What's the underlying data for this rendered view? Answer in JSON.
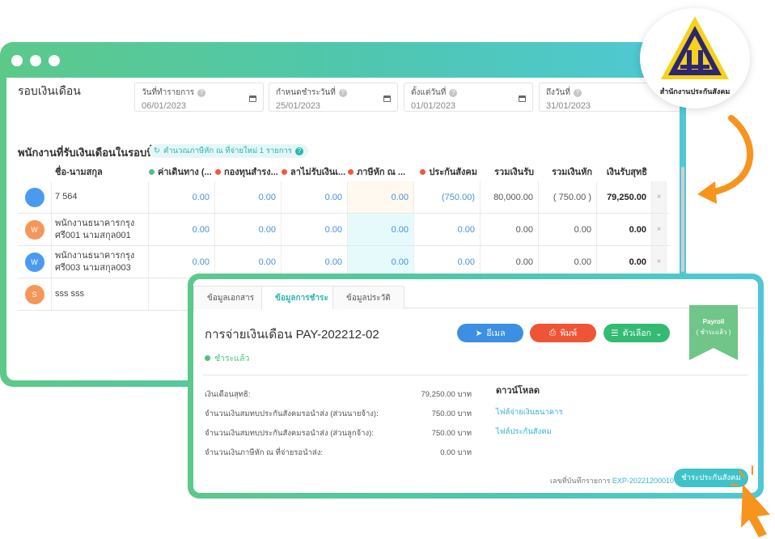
{
  "back": {
    "title": "รอบเงินเดือน",
    "dates": [
      {
        "label": "วันที่ทำรายการ",
        "value": "06/01/2023"
      },
      {
        "label": "กำหนดชำระวันที่",
        "value": "25/01/2023"
      },
      {
        "label": "ตั้งแต่วันที่",
        "value": "01/01/2023"
      },
      {
        "label": "ถึงวันที่",
        "value": "31/01/2023"
      }
    ],
    "section_title": "พนักงานที่รับเงินเดือนในรอบนี้",
    "recalc": "คำนวณภาษีหัก ณ ที่จ่ายใหม่ 1 รายการ",
    "headers": {
      "name": "ชื่อ-นามสกุล",
      "travel": "ค่าเดินทาง (...",
      "fund": "กองทุนสำรง...",
      "leave": "ลาไม่รับเงินเ...",
      "tax": "ภาษีหัก ณ ...",
      "sso": "ประกันสังคม",
      "income": "รวมเงินรับ",
      "deduct": "รวมเงินหัก",
      "net": "เงินรับสุทธิ"
    },
    "rows": [
      {
        "initial": "",
        "name1": "7 564",
        "name2": "",
        "travel": "0.00",
        "fund": "0.00",
        "leave": "0.00",
        "tax": "0.00",
        "sso": "(750.00)",
        "income": "80,000.00",
        "deduct": "( 750.00 )",
        "net": "79,250.00",
        "x": "×"
      },
      {
        "initial": "W",
        "name1": "พนักงานธนาคารกรุง",
        "name2": "ศรี001 นามสกุล001",
        "travel": "0.00",
        "fund": "0.00",
        "leave": "0.00",
        "tax": "0.00",
        "sso": "0.00",
        "income": "0.00",
        "deduct": "0.00",
        "net": "0.00",
        "x": "×"
      },
      {
        "initial": "W",
        "name1": "พนักงานธนาคารกรุง",
        "name2": "ศรี003 นามสกุล003",
        "travel": "0.00",
        "fund": "0.00",
        "leave": "0.00",
        "tax": "0.00",
        "sso": "0.00",
        "income": "0.00",
        "deduct": "0.00",
        "net": "0.00",
        "x": "×"
      },
      {
        "initial": "S",
        "name1": "sss sss",
        "name2": "",
        "travel": "",
        "fund": "",
        "leave": "",
        "tax": "",
        "sso": "",
        "income": "",
        "deduct": "",
        "net": "",
        "x": ""
      }
    ]
  },
  "front": {
    "tabs": [
      "ข้อมูลเอกสาร",
      "ข้อมูลการชำระ",
      "ข้อมูลประวัติ"
    ],
    "title": "การจ่ายเงินเดือน PAY-202212-02",
    "status": "ชำระแล้ว",
    "buttons": {
      "email": "อีเมล",
      "print": "พิมพ์",
      "options": "ตัวเลือก"
    },
    "ribbon": {
      "line1": "Payroll",
      "line2": "( ชำระแล้ว )"
    },
    "info": [
      {
        "label": "เงินเดือนสุทธิ:",
        "value": "79,250.00 บาท"
      },
      {
        "label": "จำนวนเงินสมทบประกันสังคมรอนำส่ง (ส่วนนายจ้าง):",
        "value": "750.00 บาท"
      },
      {
        "label": "จำนวนเงินสมทบประกันสังคมรอนำส่ง (ส่วนลูกจ้าง):",
        "value": "750.00 บาท"
      },
      {
        "label": "จำนวนเงินภาษีหัก ณ ที่จ่ายรอนำส่ง:",
        "value": "0.00 บาท"
      }
    ],
    "download_title": "ดาวน์โหลด",
    "downloads": [
      "ไฟล์จ่ายเงินธนาคาร",
      "ไฟล์ประกันสังคม"
    ],
    "ref_label": "เลขที่บันทึกรายการ",
    "ref_value": "EXP-20221200010",
    "pay_sso": "ชำระประกันสังคม"
  },
  "logo": {
    "text": "สำนักงานประกันสังคม"
  },
  "colors": {
    "teal": "#2bb6b0",
    "green": "#4cc27f",
    "orange": "#f7941d",
    "red": "#ee5a3a",
    "blue": "#3d8fe3"
  }
}
